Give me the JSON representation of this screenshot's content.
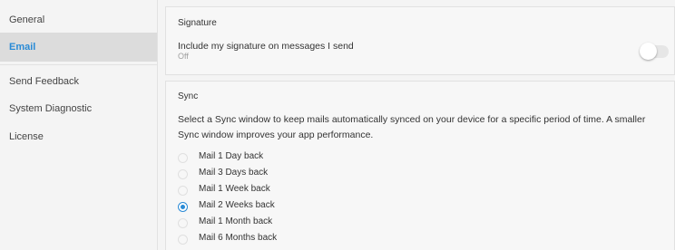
{
  "sidebar": {
    "items": [
      {
        "label": "General"
      },
      {
        "label": "Email"
      },
      {
        "label": "Send Feedback"
      },
      {
        "label": "System Diagnostic"
      },
      {
        "label": "License"
      }
    ],
    "active": "Email"
  },
  "signature": {
    "title": "Signature",
    "option_label": "Include my signature on messages I send",
    "status": "Off",
    "toggle_on": false
  },
  "sync": {
    "title": "Sync",
    "description": "Select a Sync window to keep mails automatically synced on your device for a specific period of time. A smaller Sync window improves your app performance.",
    "options": [
      {
        "label": "Mail 1 Day back",
        "checked": false
      },
      {
        "label": "Mail 3 Days back",
        "checked": false
      },
      {
        "label": "Mail 1 Week back",
        "checked": false
      },
      {
        "label": "Mail 2 Weeks back",
        "checked": true
      },
      {
        "label": "Mail 1 Month back",
        "checked": false
      },
      {
        "label": "Mail 6 Months back",
        "checked": false
      }
    ]
  },
  "colors": {
    "accent": "#2a8bd6",
    "sidebar_active_bg": "#dcdcdc"
  }
}
